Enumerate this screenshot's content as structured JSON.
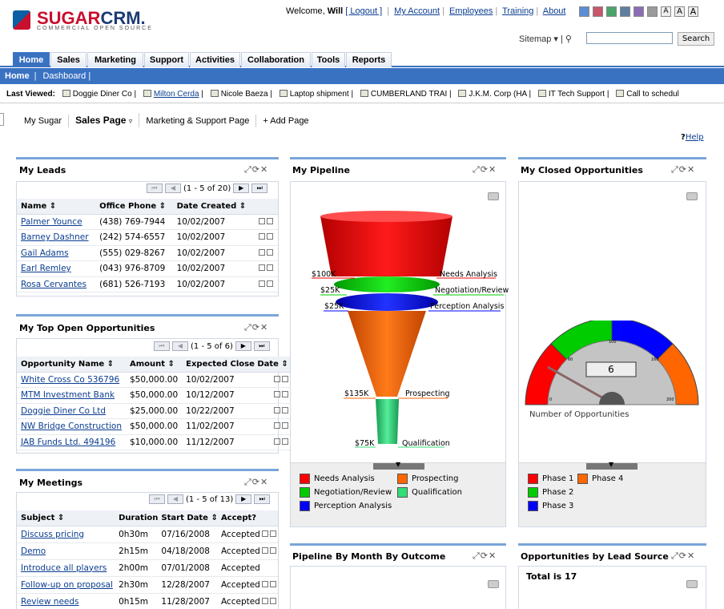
{
  "brand": {
    "name_a": "SUGAR",
    "name_b": "CRM.",
    "tagline": "COMMERCIAL OPEN SOURCE"
  },
  "header": {
    "welcome": "Welcome,",
    "user": "Will",
    "logout": "[ Logout ]",
    "links": [
      "My Account",
      "Employees",
      "Training",
      "About"
    ],
    "theme_colors": [
      "#5b8fd4",
      "#c9566b",
      "#4aa56b",
      "#5f7f9f",
      "#8c6cb8",
      "#9a9a9a"
    ],
    "font_sizes": [
      "A",
      "A",
      "A"
    ],
    "sitemap": "Sitemap",
    "search_button": "Search"
  },
  "tabs": [
    "Home",
    "Sales",
    "Marketing",
    "Support",
    "Activities",
    "Collaboration",
    "Tools",
    "Reports"
  ],
  "subnav": {
    "home": "Home",
    "dashboard": "Dashboard"
  },
  "last_viewed": {
    "label": "Last Viewed:",
    "items": [
      "Doggie Diner Co",
      "Milton Cerda",
      "Nicole Baeza",
      "Laptop shipment",
      "CUMBERLAND TRAI",
      "J.K.M. Corp (HA",
      "IT Tech Support",
      "Call to schedul"
    ]
  },
  "page_tabs": [
    "My Sugar",
    "Sales Page",
    "Marketing & Support Page",
    "+ Add Page"
  ],
  "help": "Help",
  "leads": {
    "title": "My Leads",
    "pager": "(1 - 5 of 20)",
    "cols": [
      "Name",
      "Office Phone",
      "Date Created"
    ],
    "rows": [
      [
        "Palmer Younce",
        "(438) 769-7944",
        "10/02/2007"
      ],
      [
        "Barney Dashner",
        "(242) 574-6557",
        "10/02/2007"
      ],
      [
        "Gail Adams",
        "(555) 029-8267",
        "10/02/2007"
      ],
      [
        "Earl Remley",
        "(043) 976-8709",
        "10/02/2007"
      ],
      [
        "Rosa Cervantes",
        "(681) 526-7193",
        "10/02/2007"
      ]
    ]
  },
  "opps": {
    "title": "My Top Open Opportunities",
    "pager": "(1 - 5 of 6)",
    "cols": [
      "Opportunity Name",
      "Amount",
      "Expected Close Date"
    ],
    "rows": [
      [
        "White Cross Co 536796",
        "$50,000.00",
        "10/02/2007"
      ],
      [
        "MTM Investment Bank",
        "$50,000.00",
        "10/12/2007"
      ],
      [
        "Doggie Diner Co Ltd",
        "$25,000.00",
        "10/22/2007"
      ],
      [
        "NW Bridge Construction",
        "$50,000.00",
        "11/02/2007"
      ],
      [
        "JAB Funds Ltd. 494196",
        "$10,000.00",
        "11/12/2007"
      ]
    ]
  },
  "meetings": {
    "title": "My Meetings",
    "pager": "(1 - 5 of 13)",
    "cols": [
      "Subject",
      "Duration",
      "Start Date",
      "Accept?"
    ],
    "rows": [
      [
        "Discuss pricing",
        "0h30m",
        "07/16/2008",
        "Accepted"
      ],
      [
        "Demo",
        "2h15m",
        "04/18/2008",
        "Accepted"
      ],
      [
        "Introduce all players",
        "2h00m",
        "07/01/2008",
        "Accepted"
      ],
      [
        "Follow-up on proposal",
        "2h30m",
        "12/28/2007",
        "Accepted"
      ],
      [
        "Review needs",
        "0h15m",
        "11/28/2007",
        "Accepted"
      ]
    ]
  },
  "pipeline": {
    "title": "My Pipeline"
  },
  "closed": {
    "title": "My Closed Opportunities",
    "value": "6",
    "caption": "Number of Opportunities",
    "ticks": [
      "0",
      "60",
      "100",
      "160",
      "200"
    ],
    "legend": [
      "Phase 1",
      "Phase 4",
      "Phase 2",
      "Phase 3"
    ],
    "colors": [
      "#ff0000",
      "#ff6600",
      "#00cc00",
      "#0000ff"
    ]
  },
  "bymonth": {
    "title": "Pipeline By Month By Outcome"
  },
  "bysource": {
    "title": "Opportunities by Lead Source",
    "total": "Total is 17"
  },
  "chart_data": [
    {
      "type": "funnel",
      "categories": [
        "Needs Analysis",
        "Negotiation/Review",
        "Perception Analysis",
        "Prospecting",
        "Qualification"
      ],
      "value_labels": [
        "$100K",
        "$25K",
        "$25K",
        "$135K",
        "$75K"
      ],
      "colors": [
        "#ff0000",
        "#00cc00",
        "#0000ff",
        "#ff6600",
        "#33dd77"
      ]
    },
    {
      "type": "gauge",
      "value": 6,
      "ticks": [
        0,
        60,
        100,
        160,
        200
      ],
      "caption": "Number of Opportunities"
    }
  ]
}
